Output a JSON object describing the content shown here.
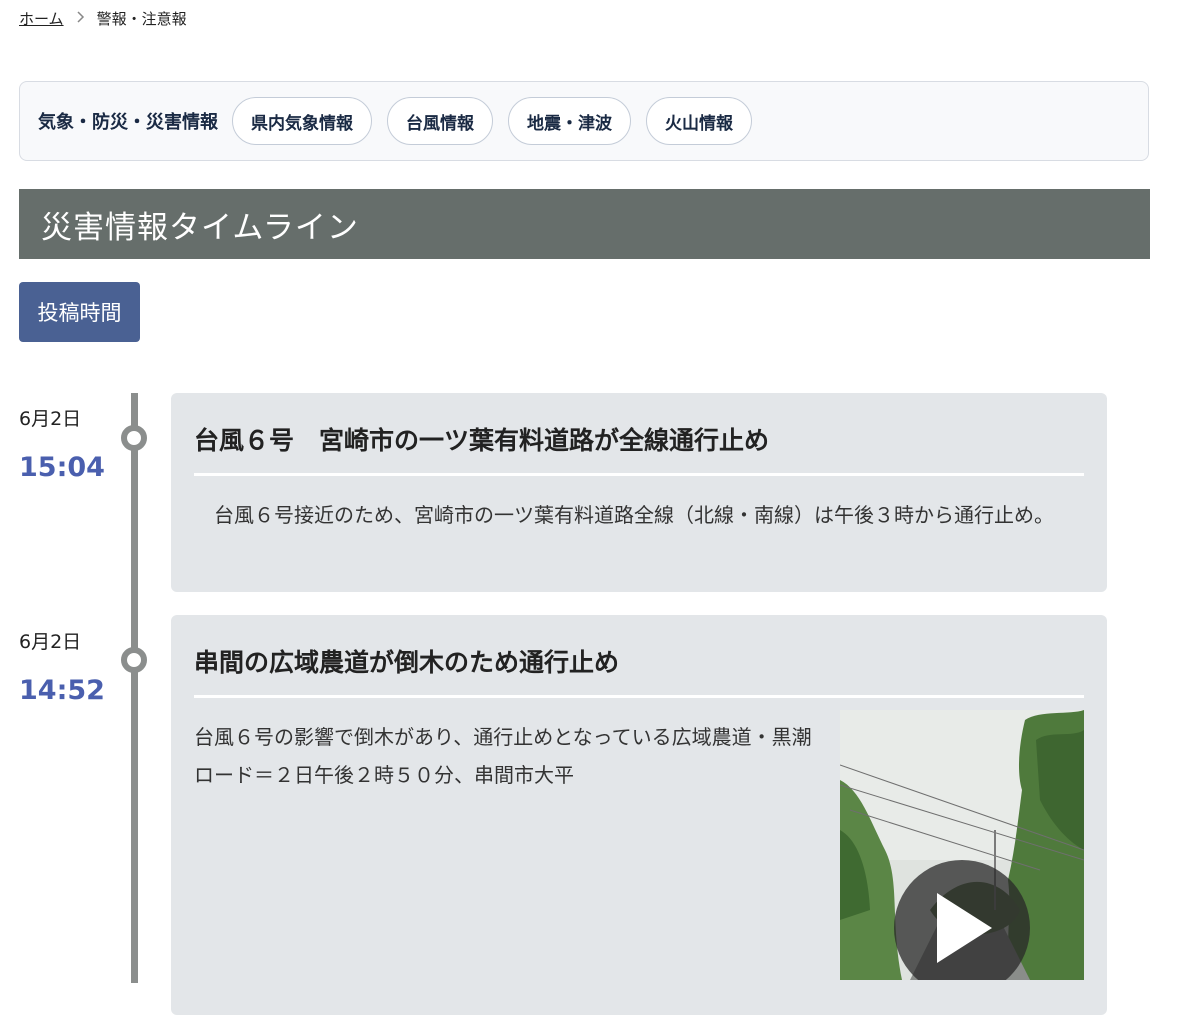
{
  "breadcrumb": {
    "home": "ホーム",
    "current": "警報・注意報"
  },
  "categories": {
    "title": "気象・防災・災害情報",
    "items": [
      "県内気象情報",
      "台風情報",
      "地震・津波",
      "火山情報"
    ]
  },
  "header": {
    "title": "災害情報タイムライン"
  },
  "sort": {
    "label": "投稿時間"
  },
  "timeline": [
    {
      "date": "6月2日",
      "time": "15:04",
      "title": "台風６号　宮崎市の一ツ葉有料道路が全線通行止め",
      "body": "　台風６号接近のため、宮崎市の一ツ葉有料道路全線（北線・南線）は午後３時から通行止め。"
    },
    {
      "date": "6月2日",
      "time": "14:52",
      "title": "串間の広域農道が倒木のため通行止め",
      "body": "台風６号の影響で倒木があり、通行止めとなっている広域農道・黒潮ロード＝２日午後２時５０分、串間市大平",
      "media": "video-thumbnail"
    }
  ],
  "colors": {
    "accent": "#4a6193",
    "time": "#4a5fae",
    "header_bg": "#666e6b",
    "card_bg": "#e3e6e9"
  }
}
